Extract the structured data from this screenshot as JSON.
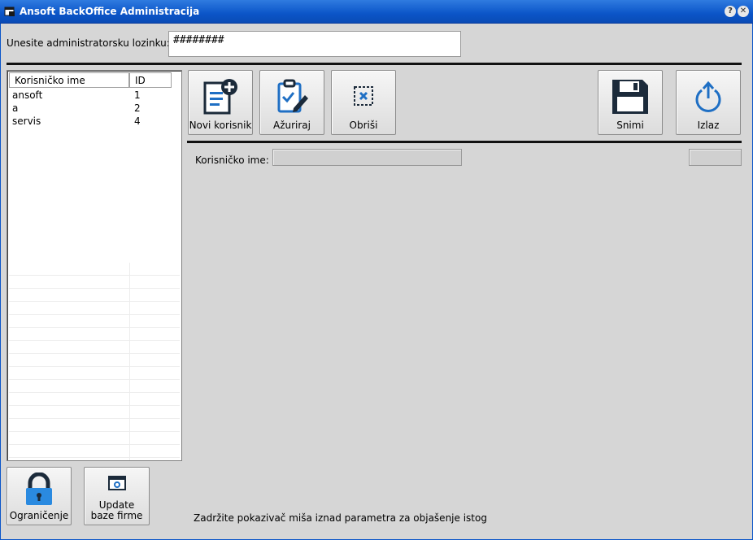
{
  "window": {
    "title": "Ansoft BackOffice Administracija",
    "help_glyph": "?",
    "close_glyph": "✕"
  },
  "password": {
    "label": "Unesite administratorsku lozinku:",
    "value": "########"
  },
  "users": {
    "columns": [
      "Korisničko ime",
      "ID"
    ],
    "rows": [
      {
        "name": "ansoft",
        "id": "1"
      },
      {
        "name": "a",
        "id": "2"
      },
      {
        "name": "servis",
        "id": "4"
      }
    ]
  },
  "toolbar": {
    "new_user": "Novi korisnik",
    "update": "Ažuriraj",
    "delete": "Obriši",
    "save": "Snimi",
    "exit": "Izlaz"
  },
  "detail": {
    "username_label": "Korisničko ime:",
    "username_value": "",
    "id_value": ""
  },
  "bottom": {
    "restriction": "Ograničenje",
    "update_db": "Update baze firme"
  },
  "status_text": "Zadržite pokazivač miša iznad parametra za objašenje istog",
  "colors": {
    "title_bar": "#0b55c8",
    "icon_blue": "#1f6fc4",
    "icon_dark": "#1b2a3a"
  }
}
